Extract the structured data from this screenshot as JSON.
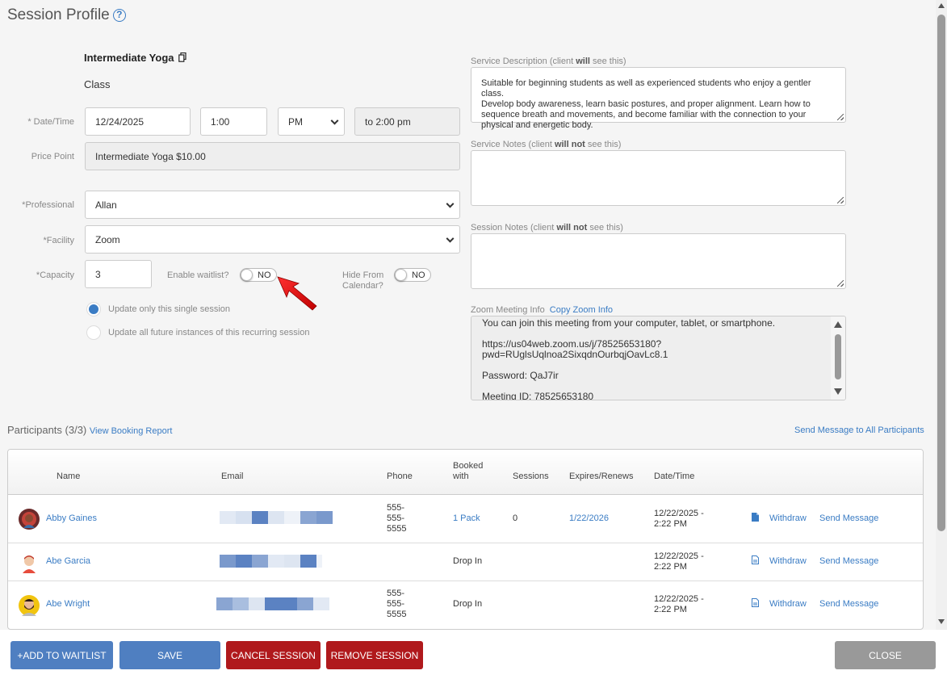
{
  "header": {
    "title": "Session Profile",
    "help_icon": "?"
  },
  "service": {
    "name": "Intermediate Yoga",
    "type": "Class",
    "copy_icon": "copy-icon"
  },
  "form": {
    "datetime_label": "* Date/Time",
    "date": "12/24/2025",
    "time": "1:00",
    "ampm": "PM",
    "end_time": "to 2:00 pm",
    "price_label": "Price Point",
    "price": "Intermediate Yoga $10.00",
    "professional_label": "*Professional",
    "professional": "Allan",
    "facility_label": "*Facility",
    "facility": "Zoom",
    "capacity_label": "*Capacity",
    "capacity": "3",
    "waitlist_label": "Enable waitlist?",
    "waitlist_value": "NO",
    "hide_label_1": "Hide From",
    "hide_label_2": "Calendar?",
    "hide_value": "NO",
    "radio_single": "Update only this single session",
    "radio_all": "Update all future instances of this recurring session"
  },
  "right": {
    "desc_label_pre": "Service Description (client ",
    "desc_label_bold": "will",
    "desc_label_post": " see this)",
    "description_lines": [
      "Suitable for beginning students as well as experienced students who enjoy a gentler class.",
      "Develop body awareness, learn basic postures, and proper alignment. Learn how to",
      "sequence breath and movements, and become familiar with the connection to your",
      "physical and energetic body."
    ],
    "svc_notes_label_pre": "Service Notes (client ",
    "svc_notes_label_bold": "will not",
    "svc_notes_label_post": " see this)",
    "session_notes_label_pre": "Session Notes (client ",
    "session_notes_label_bold": "will not",
    "session_notes_label_post": " see this)",
    "zoom_label": "Zoom Meeting Info",
    "zoom_copy": "Copy Zoom Info",
    "zoom_lines": {
      "l1": "You can join this meeting from your computer, tablet, or smartphone.",
      "l2": "https://us04web.zoom.us/j/78525653180?",
      "l3": "pwd=RUglsUqlnoa2SixqdnOurbqjOavLc8.1",
      "l4": "Password: QaJ7ir",
      "l5": "Meeting ID: 78525653180"
    }
  },
  "participants": {
    "title": "Participants (3/3)",
    "view_report": "View Booking Report",
    "send_all": "Send Message to All Participants",
    "columns": {
      "name": "Name",
      "email": "Email",
      "phone": "Phone",
      "booked_1": "Booked",
      "booked_2": "with",
      "sessions": "Sessions",
      "expires": "Expires/Renews",
      "datetime": "Date/Time"
    },
    "rows": [
      {
        "name": "Abby Gaines",
        "phone_1": "555-",
        "phone_2": "555-",
        "phone_3": "5555",
        "booked": "1 Pack",
        "sessions": "0",
        "expires": "1/22/2026",
        "date_1": "12/22/2025 -",
        "date_2": "2:22 PM",
        "withdraw": "Withdraw",
        "send": "Send Message"
      },
      {
        "name": "Abe Garcia",
        "phone_1": "",
        "phone_2": "",
        "phone_3": "",
        "booked": "Drop In",
        "sessions": "",
        "expires": "",
        "date_1": "12/22/2025 -",
        "date_2": "2:22 PM",
        "withdraw": "Withdraw",
        "send": "Send Message"
      },
      {
        "name": "Abe Wright",
        "phone_1": "555-",
        "phone_2": "555-",
        "phone_3": "5555",
        "booked": "Drop In",
        "sessions": "",
        "expires": "",
        "date_1": "12/22/2025 -",
        "date_2": "2:22 PM",
        "withdraw": "Withdraw",
        "send": "Send Message"
      }
    ]
  },
  "buttons": {
    "waitlist": "+ADD TO WAITLIST",
    "save": "SAVE",
    "cancel": "CANCEL SESSION",
    "remove": "REMOVE SESSION",
    "close": "CLOSE"
  },
  "colors": {
    "primary": "#4f7fc1",
    "danger": "#b0191c",
    "neutral": "#999999",
    "link": "#3a7cc4"
  }
}
